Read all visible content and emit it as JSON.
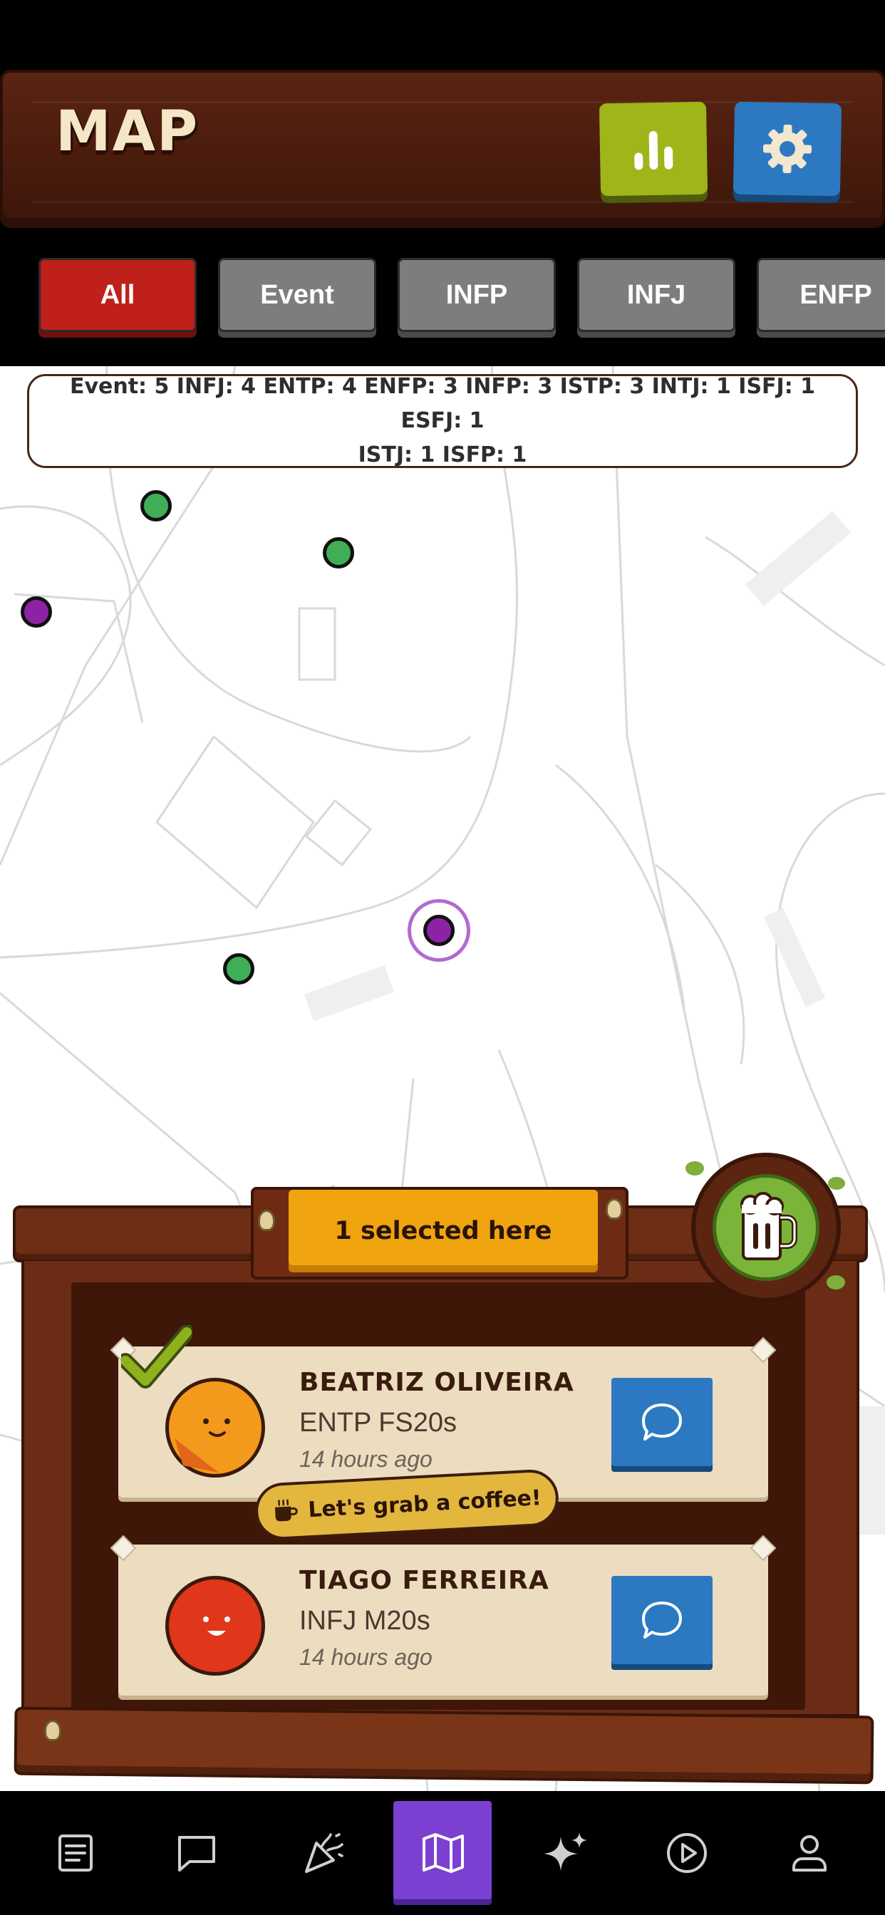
{
  "header": {
    "title": "MAP",
    "stats_icon": "bar-chart-icon",
    "settings_icon": "gear-icon",
    "colors": {
      "stats": "#9fb519",
      "settings": "#2c79c2",
      "wood": "#4a1c0d"
    }
  },
  "filters": {
    "tabs": [
      {
        "label": "All",
        "active": true
      },
      {
        "label": "Event",
        "active": false
      },
      {
        "label": "INFP",
        "active": false
      },
      {
        "label": "INFJ",
        "active": false
      },
      {
        "label": "ENFP",
        "active": false
      }
    ]
  },
  "map": {
    "type_counts_line1": "Event: 5   INFJ: 4   ENTP: 4   ENFP: 3   INFP: 3   ISTP: 3   INTJ: 1   ISFJ: 1   ESFJ: 1",
    "type_counts_line2": "ISTJ: 1   ISFP: 1",
    "marker_colors": {
      "green": "#3fae55",
      "purple": "#8e22a5",
      "selected_ring": "#b26ad0"
    }
  },
  "panel": {
    "selected_label": "1 selected here",
    "coffee_icon": "beer-mug-icon",
    "coffee_pill_label": "Let's grab a coffee!",
    "coffee_pill_icon": "coffee-cup-icon",
    "cards": [
      {
        "name": "Beatriz Oliveira",
        "subtitle": "ENTP FS20s",
        "time": "14 hours ago",
        "avatar_color": "#f39a1c",
        "checked": true,
        "chat_icon": "chat-bubble-icon"
      },
      {
        "name": "Tiago Ferreira",
        "subtitle": "INFJ M20s",
        "time": "14 hours ago",
        "avatar_color": "#e0361a",
        "checked": false,
        "chat_icon": "chat-bubble-icon"
      }
    ]
  },
  "bottom_nav": {
    "items": [
      {
        "icon": "document-list-icon",
        "active": false
      },
      {
        "icon": "chat-icon",
        "active": false
      },
      {
        "icon": "party-popper-icon",
        "active": false
      },
      {
        "icon": "map-icon",
        "active": true
      },
      {
        "icon": "sparkles-icon",
        "active": false
      },
      {
        "icon": "play-circle-icon",
        "active": false
      },
      {
        "icon": "profile-icon",
        "active": false
      }
    ],
    "active_color": "#7b3fd1"
  }
}
